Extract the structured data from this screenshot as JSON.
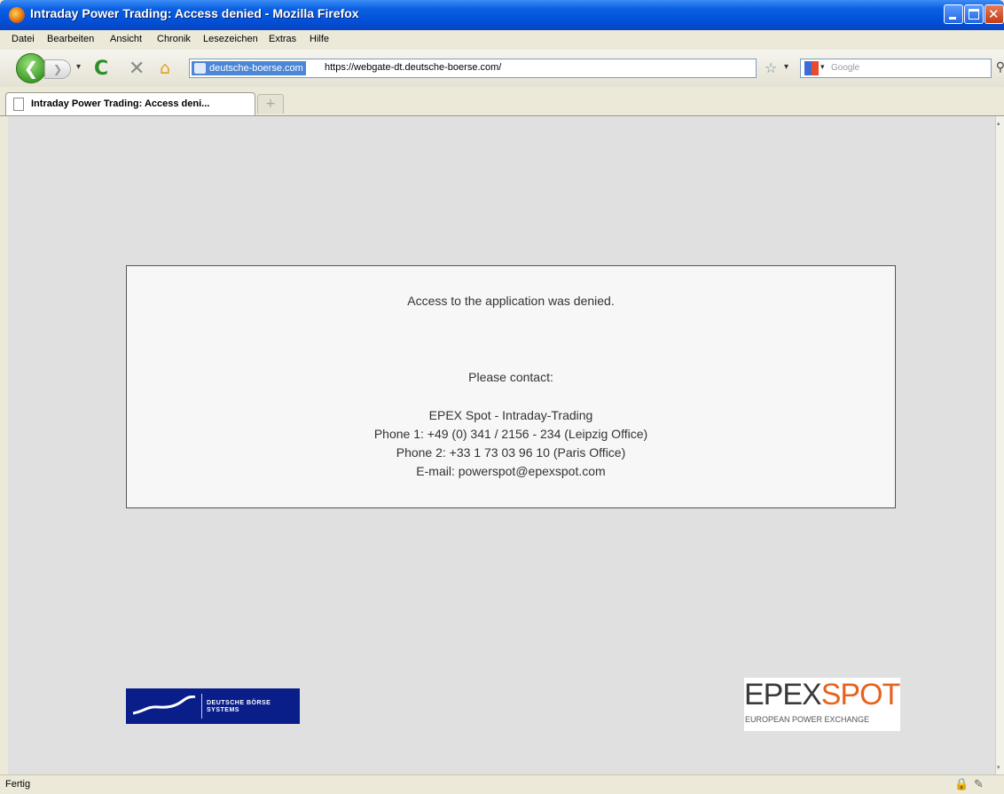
{
  "window": {
    "title": "Intraday Power Trading: Access denied - Mozilla Firefox"
  },
  "menu": [
    "Datei",
    "Bearbeiten",
    "Ansicht",
    "Chronik",
    "Lesezeichen",
    "Extras",
    "Hilfe"
  ],
  "nav": {
    "site_identity": "deutsche-boerse.com",
    "url": "https://webgate-dt.deutsche-boerse.com/",
    "search_placeholder": "Google"
  },
  "tab": {
    "label": "Intraday Power Trading: Access deni..."
  },
  "message": {
    "line1": "Access to the application was denied.",
    "contact_heading": "Please contact:",
    "org": "EPEX Spot - Intraday-Trading",
    "phone1": "Phone 1: +49 (0) 341 / 2156 - 234 (Leipzig Office)",
    "phone2": "Phone 2: +33 1 73 03 96 10 (Paris Office)",
    "email": "E-mail: powerspot@epexspot.com"
  },
  "logos": {
    "dbs_line1": "DEUTSCHE BÖRSE",
    "dbs_line2": "SYSTEMS",
    "epex_part1": "EPEX",
    "epex_part2": "SPOT",
    "epex_sub": "EUROPEAN POWER EXCHANGE"
  },
  "status": {
    "text": "Fertig"
  },
  "colors": {
    "titlebar": "#0a5fe0",
    "content_bg": "#e0e0e0",
    "dbs_blue": "#0a1e8a",
    "epex_dark": "#3a3a3a",
    "epex_orange": "#e8621e"
  },
  "icons": [
    "firefox-icon",
    "back-icon",
    "forward-icon",
    "reload-icon",
    "stop-icon",
    "home-icon",
    "bookmark-star-icon",
    "google-icon",
    "search-go-icon",
    "page-icon",
    "new-tab-icon",
    "lock-icon",
    "plug-icon"
  ]
}
